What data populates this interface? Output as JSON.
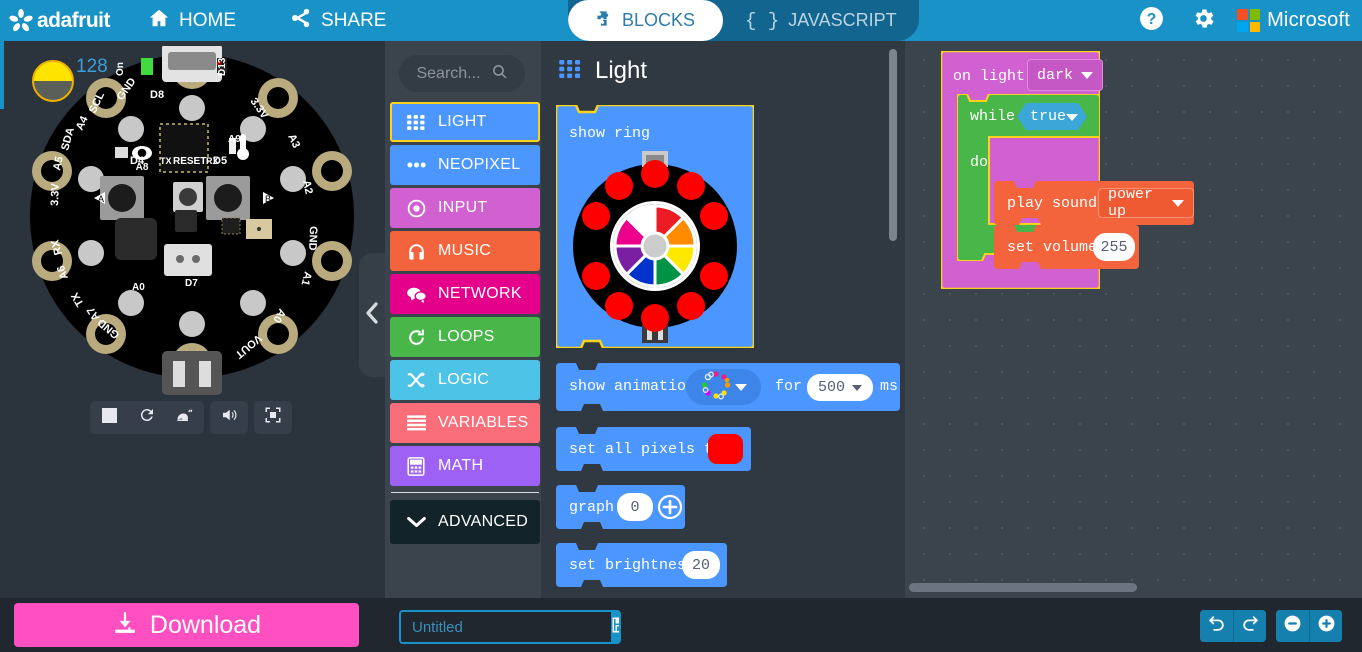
{
  "topbar": {
    "brand": "adafruit",
    "brand_icon": "adafruit-flower-icon",
    "home_label": "HOME",
    "home_icon": "home-icon",
    "share_label": "SHARE",
    "share_icon": "share-icon",
    "help_icon": "help-circle-icon",
    "settings_icon": "gear-icon",
    "microsoft_label": "Microsoft",
    "microsoft_icon": "microsoft-logo-icon",
    "accent_color": "#1892c7",
    "tabs": [
      {
        "label": "BLOCKS",
        "icon": "puzzle-piece-icon",
        "active": true
      },
      {
        "label": "JAVASCRIPT",
        "icon": "curly-braces-icon",
        "active": false
      }
    ]
  },
  "simulator": {
    "board_name": "Circuit Playground Express",
    "light_sensor_value": "128",
    "light_sensor_icon": "half-sun-icon",
    "pin_labels": [
      "GND",
      "D8",
      "3.3V",
      "A3",
      "D13",
      "On",
      "SCL",
      "A4",
      "SDA",
      "A5",
      "3.3V",
      "A2",
      "GND",
      "RX",
      "A6",
      "A1",
      "TX",
      "A7",
      "GND",
      "VOUT",
      "A0",
      "D7",
      "D4",
      "D5",
      "TX",
      "RX",
      "RESET",
      "A8",
      "A9"
    ],
    "controls": [
      {
        "label": "Stop",
        "icon": "stop-square-icon"
      },
      {
        "label": "Restart",
        "icon": "restart-icon"
      },
      {
        "label": "Slow motion",
        "icon": "snail-icon"
      },
      {
        "label": "Mute",
        "icon": "speaker-icon"
      },
      {
        "label": "Fullscreen",
        "icon": "fullscreen-icon"
      }
    ]
  },
  "toolbox": {
    "search_placeholder": "Search...",
    "search_icon": "search-icon",
    "collapse_icon": "chevron-left-icon",
    "categories": [
      {
        "label": "LIGHT",
        "color": "#4c97ff",
        "icon": "grid-dots-icon",
        "selected": true
      },
      {
        "label": "NEOPIXEL",
        "color": "#4c97ff",
        "icon": "three-dots-icon",
        "selected": false
      },
      {
        "label": "INPUT",
        "color": "#d161d1",
        "icon": "target-icon",
        "selected": false
      },
      {
        "label": "MUSIC",
        "color": "#f4643c",
        "icon": "headphones-icon",
        "selected": false
      },
      {
        "label": "NETWORK",
        "color": "#e4008a",
        "icon": "chat-bubbles-icon",
        "selected": false
      },
      {
        "label": "LOOPS",
        "color": "#48b648",
        "icon": "loop-arrow-icon",
        "selected": false
      },
      {
        "label": "LOGIC",
        "color": "#4ec3e8",
        "icon": "shuffle-icon",
        "selected": false
      },
      {
        "label": "VARIABLES",
        "color": "#fa6e79",
        "icon": "lines-icon",
        "selected": false
      },
      {
        "label": "MATH",
        "color": "#9d62f5",
        "icon": "calculator-icon",
        "selected": false
      },
      {
        "label": "ADVANCED",
        "color": "#12232a",
        "icon": "chevron-down-icon",
        "selected": false
      }
    ]
  },
  "flyout": {
    "title": "Light",
    "title_icon": "grid-dots-icon",
    "blocks": [
      {
        "id": "show-ring",
        "text": "show ring",
        "kind": "ring-picker",
        "color": "#4c97ff"
      },
      {
        "id": "show-animation",
        "text_before": "show animation",
        "text_mid": "for",
        "text_after": "ms",
        "duration": "500",
        "animation_icon": "rainbow-ring-icon",
        "color": "#4c97ff"
      },
      {
        "id": "set-all-pixels",
        "text": "set all pixels to",
        "color_value": "#ff0000",
        "color": "#4c97ff"
      },
      {
        "id": "graph",
        "text": "graph",
        "value": "0",
        "plus_icon": "plus-circle-icon",
        "color": "#4c97ff"
      },
      {
        "id": "set-brightness",
        "text": "set brightness",
        "value": "20",
        "color": "#4c97ff"
      }
    ],
    "ring_colors": [
      "#ffffff",
      "#ed1c24",
      "#ff8c00",
      "#ffe800",
      "#009245",
      "#0033cc",
      "#7b1fa2",
      "#ec008c"
    ],
    "ring_led_color": "#ff0000"
  },
  "workspace": {
    "blocks": [
      {
        "id": "on-light",
        "text": "on light",
        "dropdown": "dark",
        "color": "#d161d1",
        "children": [
          {
            "id": "while",
            "text": "while",
            "condition": "true",
            "do_label": "do",
            "color": "#48b648",
            "cond_color": "#4ec3e8",
            "children": [
              {
                "id": "play-sound",
                "text": "play sound",
                "dropdown": "power up",
                "color": "#f4643c"
              },
              {
                "id": "set-volume",
                "text": "set volume",
                "value": "255",
                "color": "#f4643c"
              }
            ]
          }
        ]
      }
    ]
  },
  "bottombar": {
    "download_label": "Download",
    "download_icon": "download-icon",
    "project_name_value": "",
    "project_name_placeholder": "Untitled",
    "save_icon": "floppy-disk-icon",
    "undo_icon": "undo-arrow-icon",
    "redo_icon": "redo-arrow-icon",
    "zoom_out_icon": "minus-circle-icon",
    "zoom_in_icon": "plus-circle-icon"
  }
}
